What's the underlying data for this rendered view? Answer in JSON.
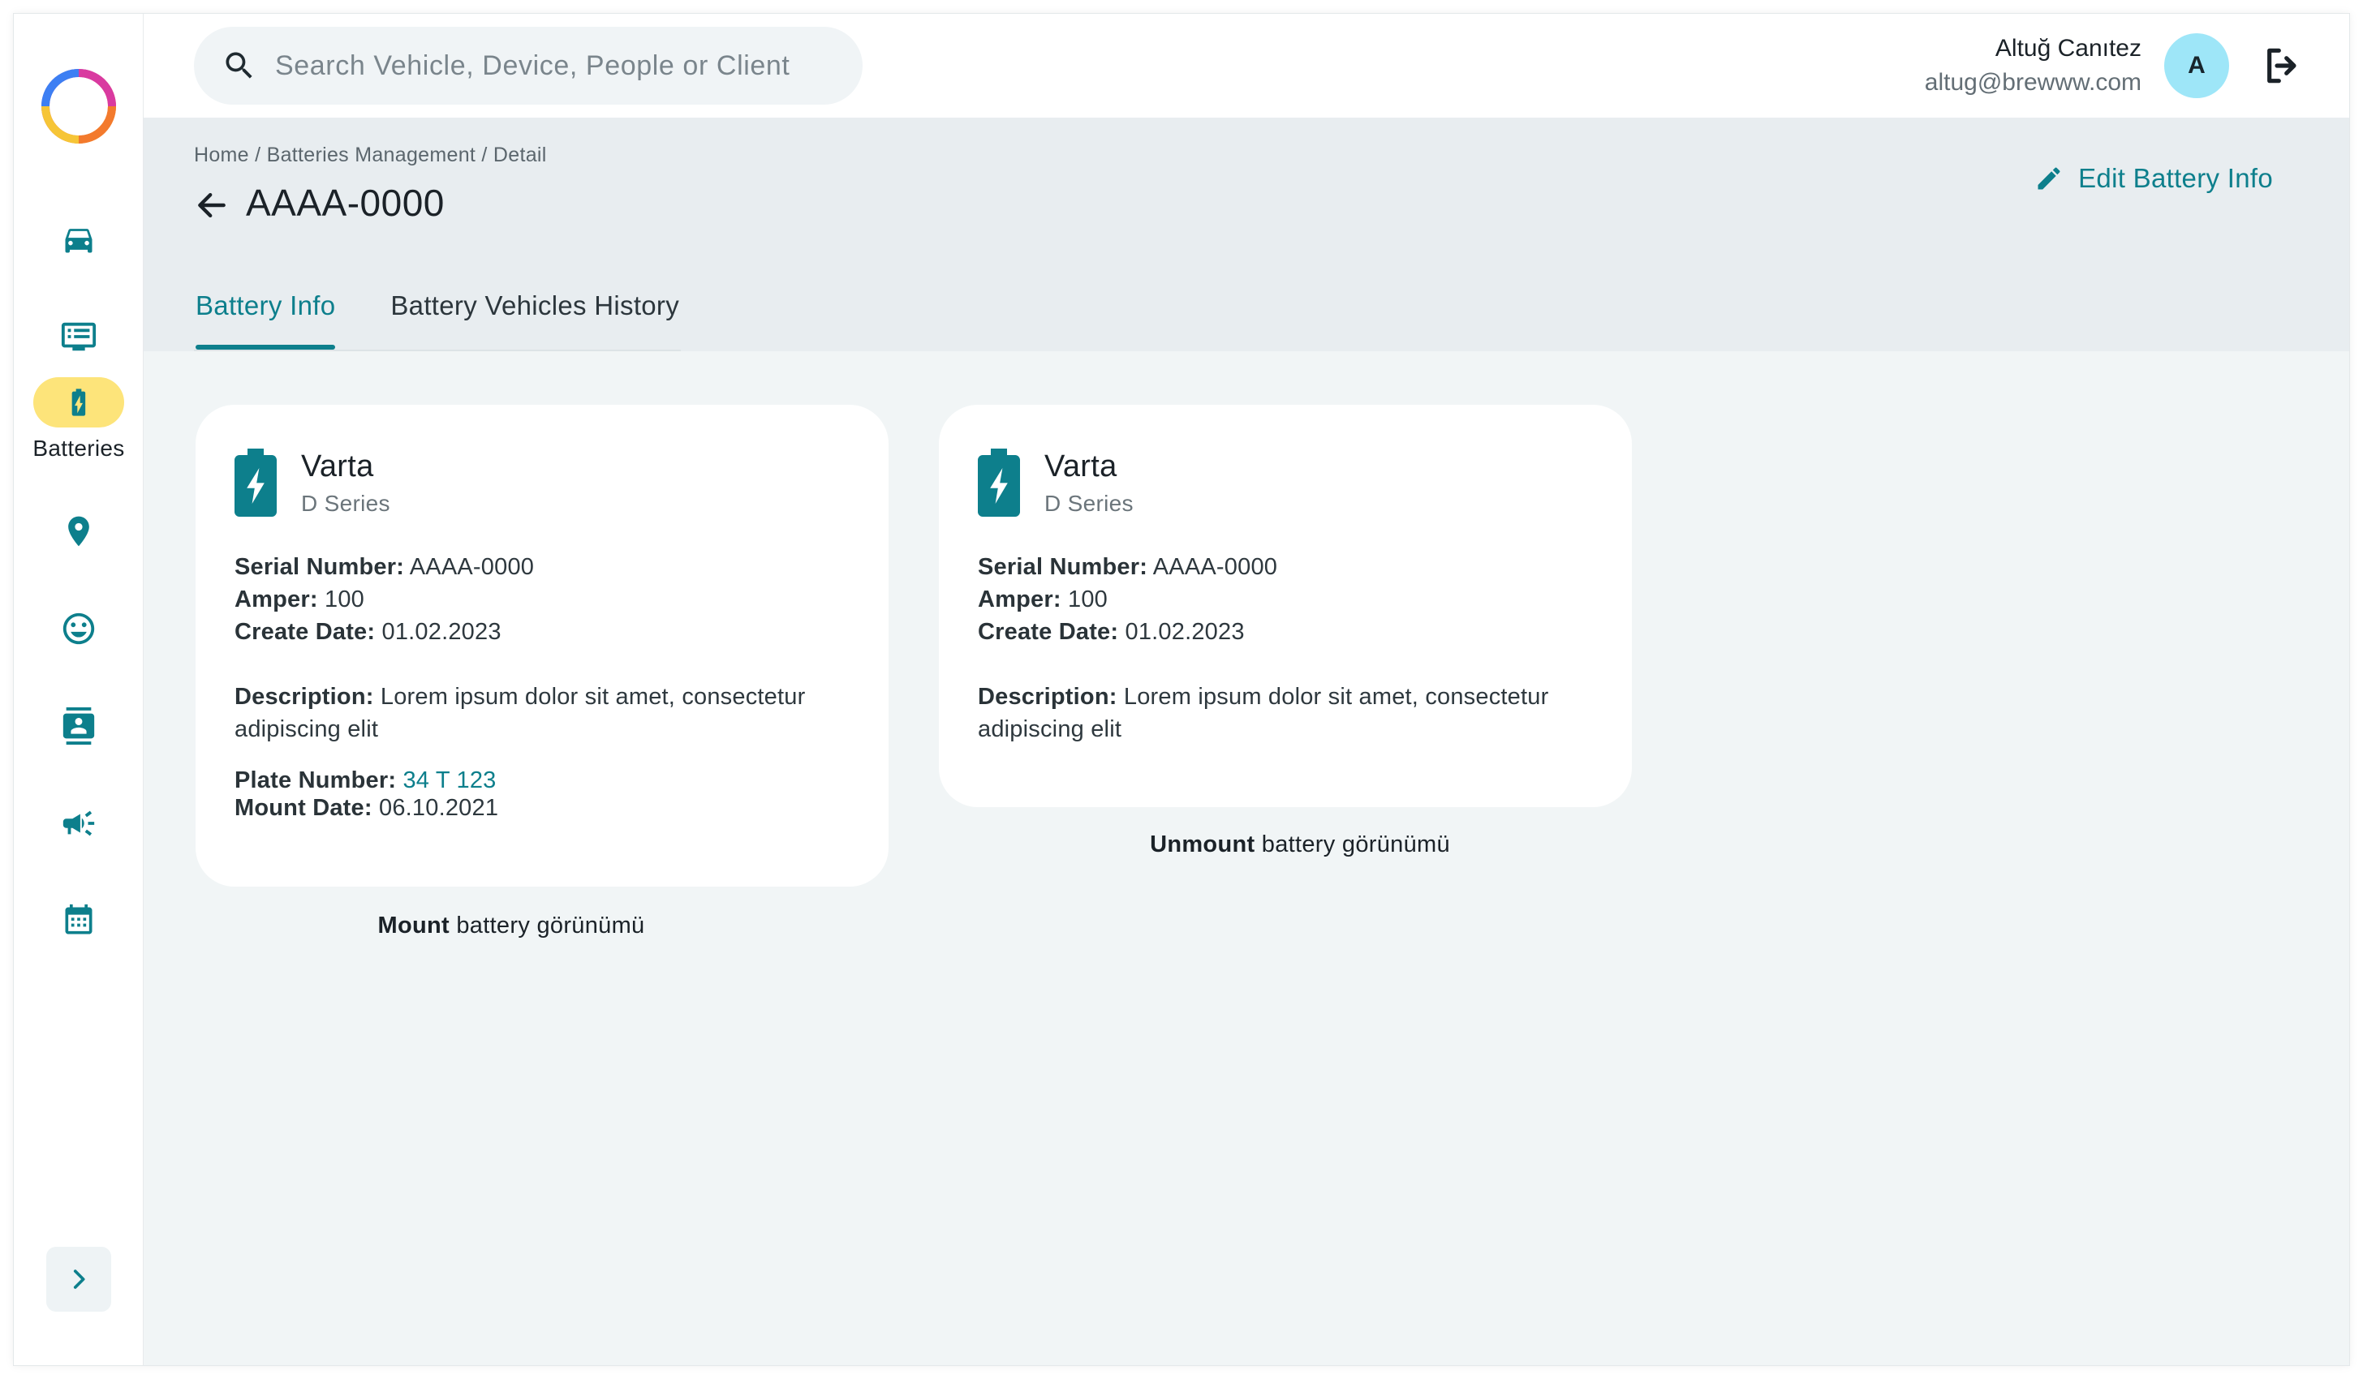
{
  "search": {
    "placeholder": "Search Vehicle, Device, People or Client"
  },
  "user": {
    "name": "Altuğ Canıtez",
    "email": "altug@brewww.com",
    "avatar_initial": "A"
  },
  "sidebar": {
    "items": [
      {
        "icon": "car-icon",
        "label": ""
      },
      {
        "icon": "monitor-list-icon",
        "label": ""
      },
      {
        "icon": "battery-charging-icon",
        "label": "Batteries",
        "active": true
      },
      {
        "icon": "location-pin-icon",
        "label": ""
      },
      {
        "icon": "smiley-icon",
        "label": ""
      },
      {
        "icon": "contact-card-icon",
        "label": ""
      },
      {
        "icon": "megaphone-icon",
        "label": ""
      },
      {
        "icon": "calendar-icon",
        "label": ""
      }
    ],
    "expand_icon": "chevron-right-icon"
  },
  "header": {
    "breadcrumb": "Home / Batteries Management / Detail",
    "title": "AAAA-0000",
    "edit_label": "Edit Battery Info",
    "tabs": [
      {
        "label": "Battery Info",
        "active": true
      },
      {
        "label": "Battery Vehicles History",
        "active": false
      }
    ]
  },
  "cards": [
    {
      "brand": "Varta",
      "series": "D Series",
      "serial_label": "Serial Number:",
      "serial": "AAAA-0000",
      "amper_label": "Amper:",
      "amper": "100",
      "create_label": "Create Date:",
      "create_date": "01.02.2023",
      "description_label": "Description:",
      "description": "Lorem ipsum dolor sit amet, consectetur adipiscing elit",
      "plate_label": "Plate Number:",
      "plate": "34 T 123",
      "mount_label": "Mount Date:",
      "mount_date": "06.10.2021",
      "caption_bold": "Mount",
      "caption_rest": "battery görünümü"
    },
    {
      "brand": "Varta",
      "series": "D Series",
      "serial_label": "Serial Number:",
      "serial": "AAAA-0000",
      "amper_label": "Amper:",
      "amper": "100",
      "create_label": "Create Date:",
      "create_date": "01.02.2023",
      "description_label": "Description:",
      "description": "Lorem ipsum dolor sit amet, consectetur adipiscing elit",
      "caption_bold": "Unmount",
      "caption_rest": "battery görünümü"
    }
  ],
  "colors": {
    "accent": "#0d7f8c",
    "active_nav": "#fde47a",
    "avatar": "#9ee6f8",
    "page_bg": "#f1f5f6",
    "header_bg": "#e8edf0"
  }
}
